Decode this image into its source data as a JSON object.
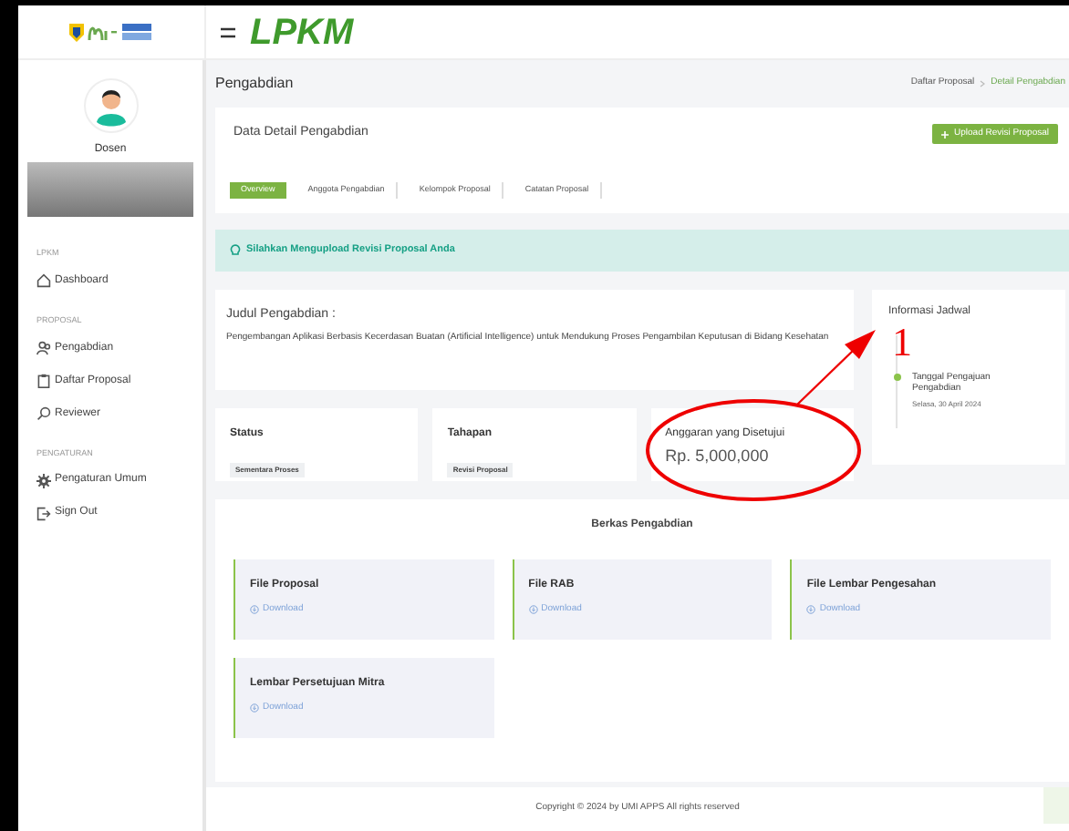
{
  "header": {
    "brand": "LPKM"
  },
  "sidebar": {
    "user_name": "Dosen",
    "sections": [
      {
        "heading": "LPKM",
        "items": [
          {
            "label": "Dashboard"
          }
        ]
      },
      {
        "heading": "PROPOSAL",
        "items": [
          {
            "label": "Pengabdian"
          },
          {
            "label": "Daftar Proposal"
          },
          {
            "label": "Reviewer"
          }
        ]
      },
      {
        "heading": "PENGATURAN",
        "items": [
          {
            "label": "Pengaturan Umum"
          },
          {
            "label": "Sign Out"
          }
        ]
      }
    ]
  },
  "page": {
    "title": "Pengabdian",
    "breadcrumb": [
      "Daftar Proposal",
      "Detail Pengabdian"
    ]
  },
  "detail_card": {
    "title": "Data Detail Pengabdian",
    "upload_button": "Upload Revisi Proposal",
    "tabs": [
      {
        "label": "Overview",
        "selected": true
      },
      {
        "label": "Anggota Pengabdian",
        "selected": false
      },
      {
        "label": "Kelompok Proposal",
        "selected": false
      },
      {
        "label": "Catatan Proposal",
        "selected": false
      }
    ]
  },
  "alert": "Silahkan Mengupload Revisi Proposal Anda",
  "judul": {
    "label": "Judul Pengabdian :",
    "text": "Pengembangan Aplikasi Berbasis Kecerdasan Buatan (Artificial Intelligence) untuk Mendukung Proses Pengambilan Keputusan di Bidang Kesehatan"
  },
  "stats": [
    {
      "label": "Status",
      "value": "Sementara Proses",
      "kind": "badge",
      "highlighted": false
    },
    {
      "label": "Tahapan",
      "value": "Revisi Proposal",
      "kind": "badge",
      "highlighted": false
    },
    {
      "label": "Anggaran yang Disetujui",
      "value": "Rp. 5,000,000",
      "kind": "amount",
      "highlighted": true
    }
  ],
  "schedule": {
    "title": "Informasi Jadwal",
    "events": [
      {
        "title": "Tanggal Pengajuan Pengabdian",
        "date": "Selasa, 30 April 2024"
      }
    ]
  },
  "files": {
    "title": "Berkas Pengabdian",
    "items": [
      {
        "name": "File Proposal",
        "link": "Download"
      },
      {
        "name": "File RAB",
        "link": "Download"
      },
      {
        "name": "File Lembar Pengesahan",
        "link": "Download"
      },
      {
        "name": "Lembar Persetujuan Mitra",
        "link": "Download"
      }
    ]
  },
  "annotation": {
    "label": "1"
  },
  "footer": "Copyright © 2024 by UMI APPS All rights reserved"
}
